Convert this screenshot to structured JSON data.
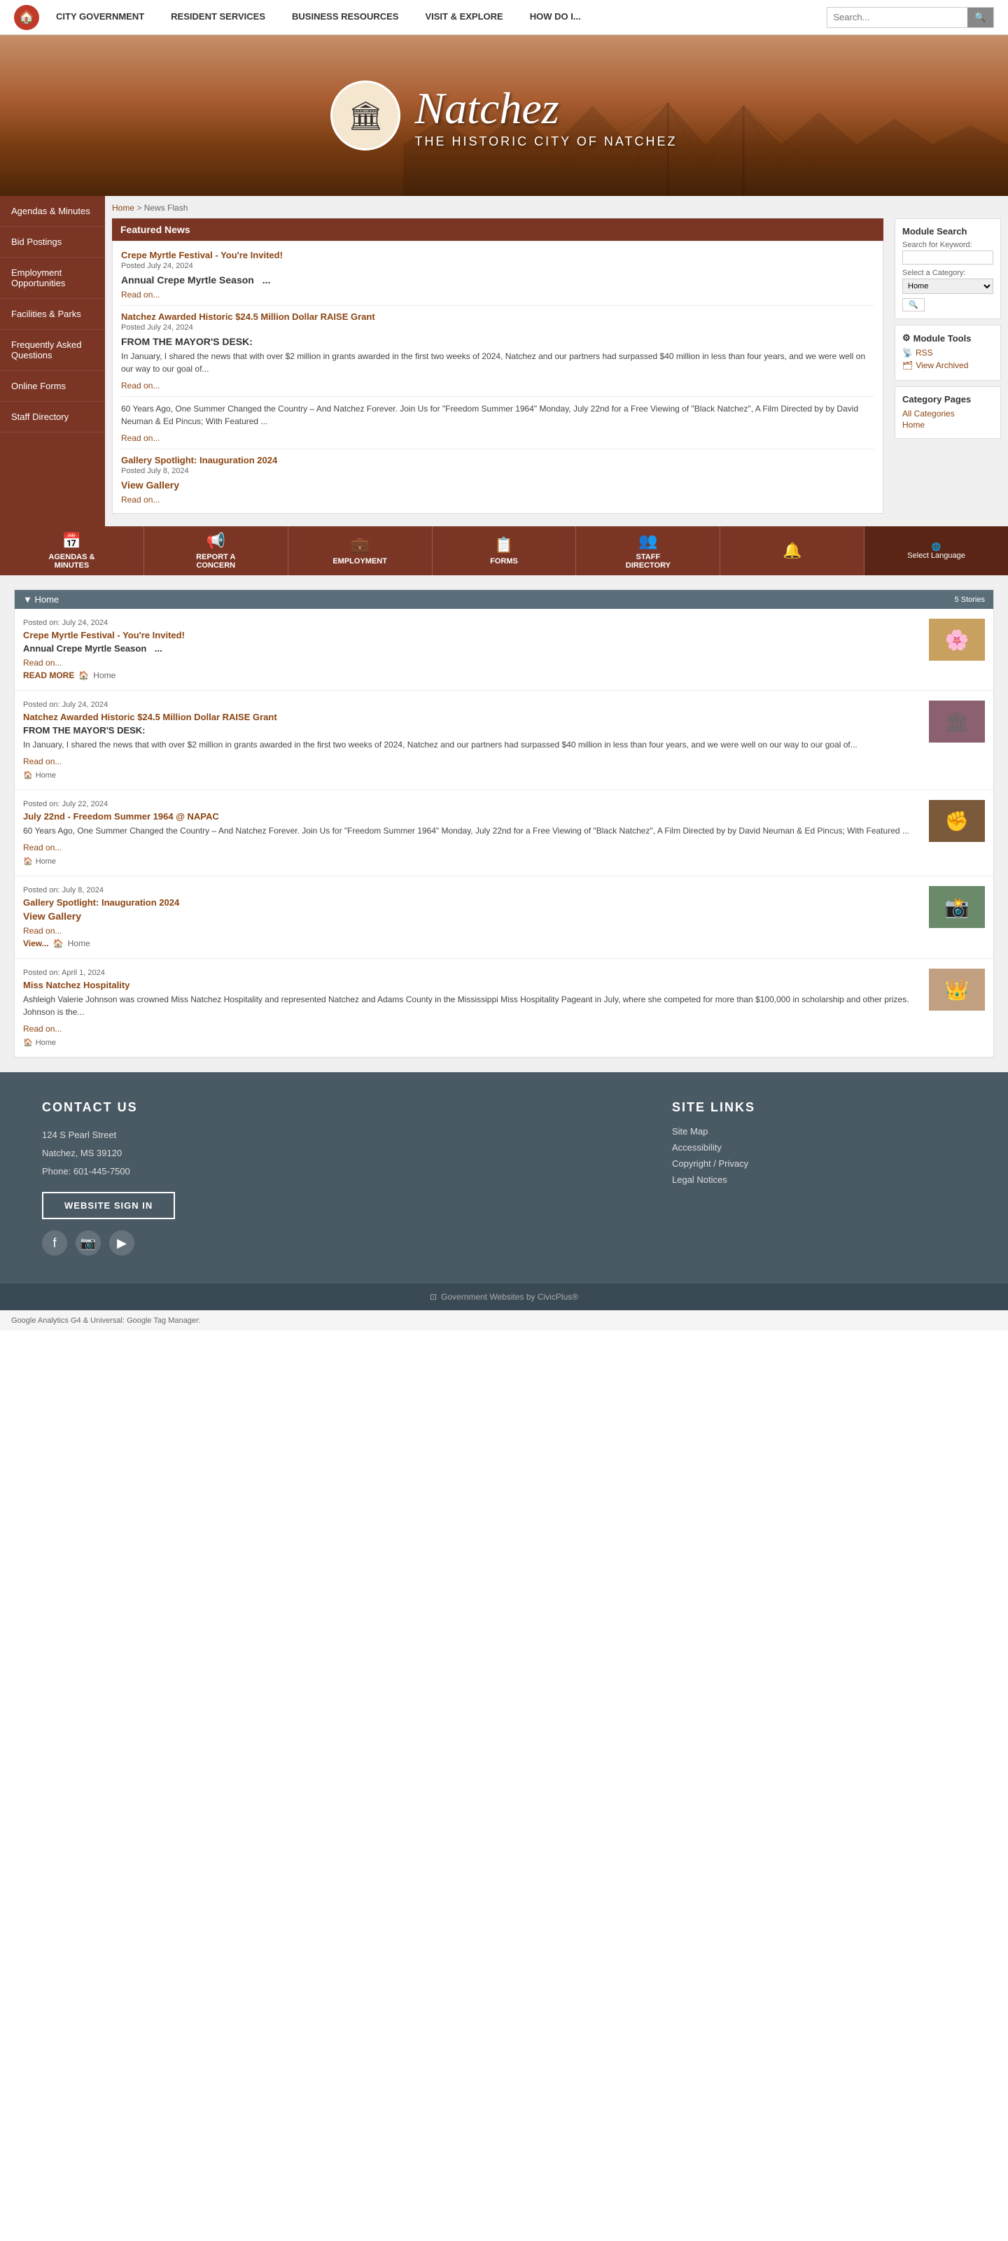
{
  "nav": {
    "home_icon": "🏠",
    "items": [
      {
        "label": "CITY GOVERNMENT"
      },
      {
        "label": "RESIDENT SERVICES"
      },
      {
        "label": "BUSINESS RESOURCES"
      },
      {
        "label": "VISIT & EXPLORE"
      },
      {
        "label": "HOW DO I..."
      }
    ],
    "search_placeholder": "Search..."
  },
  "hero": {
    "seal_icon": "🏛",
    "natchez": "Natchez",
    "subtitle": "THE HISTORIC CITY OF NATCHEZ"
  },
  "sidebar": {
    "items": [
      {
        "label": "Agendas & Minutes"
      },
      {
        "label": "Bid Postings"
      },
      {
        "label": "Employment Opportunities"
      },
      {
        "label": "Facilities & Parks"
      },
      {
        "label": "Frequently Asked Questions"
      },
      {
        "label": "Online Forms"
      },
      {
        "label": "Staff Directory"
      }
    ]
  },
  "breadcrumb": {
    "home": "Home",
    "separator": " > ",
    "current": "News Flash"
  },
  "featured_news": {
    "header": "Featured News",
    "items": [
      {
        "title": "Crepe Myrtle Festival - You're Invited!",
        "date": "Posted July 24, 2024",
        "subtitle": "Annual Crepe Myrtle Season",
        "ellipsis": "...",
        "read_on": "Read on..."
      },
      {
        "title": "Natchez Awarded Historic $24.5 Million Dollar RAISE Grant",
        "date": "Posted July 24, 2024",
        "subtitle": "FROM THE MAYOR'S DESK:",
        "text": "In January, I shared the news that with over $2 million in grants awarded in the first two weeks of 2024, Natchez and our partners had surpassed $40 million in less than four years, and we were well on our way to our goal of...",
        "read_on": "Read on..."
      }
    ]
  },
  "module_search": {
    "title": "Module Search",
    "keyword_label": "Search for Keyword:",
    "category_label": "Select a Category:",
    "category_default": "Home",
    "search_btn": "🔍"
  },
  "module_tools": {
    "title": "Module Tools",
    "rss": "RSS",
    "view_archived": "View Archived"
  },
  "category_pages": {
    "title": "Category Pages",
    "all_categories": "All Categories",
    "home": "Home"
  },
  "quick_links": [
    {
      "icon": "📅",
      "label": "AGENDAS &\nMINUTES"
    },
    {
      "icon": "📢",
      "label": "REPORT A\nCONCERN"
    },
    {
      "icon": "💼",
      "label": "EMPLOYMENT"
    },
    {
      "icon": "📋",
      "label": "FORMS"
    },
    {
      "icon": "👥",
      "label": "STAFF\nDIRECTORY"
    },
    {
      "icon": "🔔",
      "label": ""
    },
    {
      "icon": "🌐",
      "label": "Select Language"
    }
  ],
  "news_list": {
    "category": "Home",
    "stories_count": "5 Stories",
    "items": [
      {
        "date": "Posted on: July 24, 2024",
        "title": "Crepe Myrtle Festival - You're Invited!",
        "subtitle": "Annual Crepe Myrtle Season",
        "ellipsis": "...",
        "read_on": "Read on...",
        "read_more": "READ MORE",
        "category": "Home",
        "thumb_color": "#c8a060",
        "thumb_text": "🌸"
      },
      {
        "date": "Posted on: July 24, 2024",
        "title": "Natchez Awarded Historic $24.5 Million Dollar RAISE Grant",
        "subtitle": "FROM THE MAYOR'S DESK:",
        "text": "In January, I shared the news that with over $2 million in grants awarded in the first two weeks of 2024, Natchez and our partners had surpassed $40 million in less than four years, and we were well on our way to our goal of...",
        "read_on": "Read on...",
        "category": "Home",
        "thumb_color": "#8B6070",
        "thumb_text": "🏛"
      },
      {
        "date": "Posted on: July 22, 2024",
        "title": "July 22nd - Freedom Summer 1964 @ NAPAC",
        "text": "60 Years Ago, One Summer Changed the Country – And Natchez Forever. Join Us for \"Freedom Summer 1964\" Monday, July 22nd for a Free Viewing of \"Black Natchez\", A Film Directed by by David Neuman & Ed Pincus; With Featured ...",
        "read_on": "Read on...",
        "category": "Home",
        "thumb_color": "#7a5a3a",
        "thumb_text": "✊"
      },
      {
        "date": "Posted on: July 8, 2024",
        "title": "Gallery Spotlight: Inauguration 2024",
        "view_gallery": "View Gallery",
        "read_on": "Read on...",
        "view_label": "View...",
        "view_category": "Home",
        "category": "Home",
        "thumb_color": "#6a8a6a",
        "thumb_text": "📸"
      },
      {
        "date": "Posted on: April 1, 2024",
        "title": "Miss Natchez Hospitality",
        "text": "Ashleigh Valerie Johnson was crowned Miss Natchez Hospitality and represented Natchez and Adams County in the Mississippi Miss Hospitality Pageant in July, where she competed for more than $100,000 in scholarship and other prizes.  Johnson is the...",
        "read_on": "Read on...",
        "category": "Home",
        "thumb_color": "#c0a080",
        "thumb_text": "👑"
      }
    ]
  },
  "footer": {
    "contact_title": "CONTACT US",
    "address_line1": "124 S Pearl Street",
    "address_line2": "Natchez, MS 39120",
    "phone": "Phone: 601-445-7500",
    "signin_btn": "WEBSITE SIGN IN",
    "social": [
      {
        "icon": "f",
        "name": "facebook"
      },
      {
        "icon": "📷",
        "name": "instagram"
      },
      {
        "icon": "▶",
        "name": "youtube"
      }
    ],
    "links_title": "SITE LINKS",
    "links": [
      {
        "label": "Site Map"
      },
      {
        "label": "Accessibility"
      },
      {
        "label": "Copyright / Privacy"
      },
      {
        "label": "Legal Notices"
      }
    ],
    "bottom_text": "Government Websites by CivicPlus®",
    "civicplus_icon": "⊡"
  },
  "google_tag": "Google Analytics G4 & Universal: Google Tag Manager:"
}
